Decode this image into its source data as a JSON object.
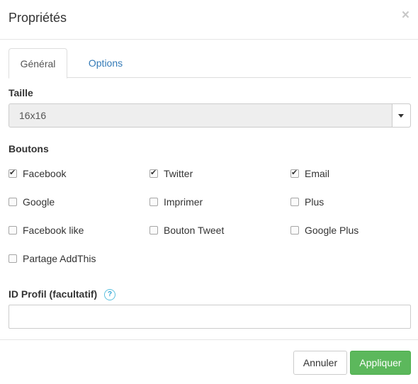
{
  "dialog": {
    "title": "Propriétés",
    "close_symbol": "×"
  },
  "tabs": [
    {
      "label": "Général",
      "active": true
    },
    {
      "label": "Options",
      "active": false
    }
  ],
  "size": {
    "label": "Taille",
    "value": "16x16"
  },
  "buttons_section": {
    "label": "Boutons",
    "checkboxes": [
      {
        "label": "Facebook",
        "checked": true
      },
      {
        "label": "Twitter",
        "checked": true
      },
      {
        "label": "Email",
        "checked": true
      },
      {
        "label": "Google",
        "checked": false
      },
      {
        "label": "Imprimer",
        "checked": false
      },
      {
        "label": "Plus",
        "checked": false
      },
      {
        "label": "Facebook like",
        "checked": false
      },
      {
        "label": "Bouton Tweet",
        "checked": false
      },
      {
        "label": "Google Plus",
        "checked": false
      },
      {
        "label": "Partage AddThis",
        "checked": false
      }
    ]
  },
  "profile": {
    "label": "ID Profil (facultatif)",
    "help_symbol": "?",
    "value": "",
    "placeholder": ""
  },
  "footer": {
    "cancel_label": "Annuler",
    "apply_label": "Appliquer"
  },
  "colors": {
    "apply_button": "#5cb85c",
    "link": "#337ab7",
    "help_icon": "#5bc0de"
  }
}
